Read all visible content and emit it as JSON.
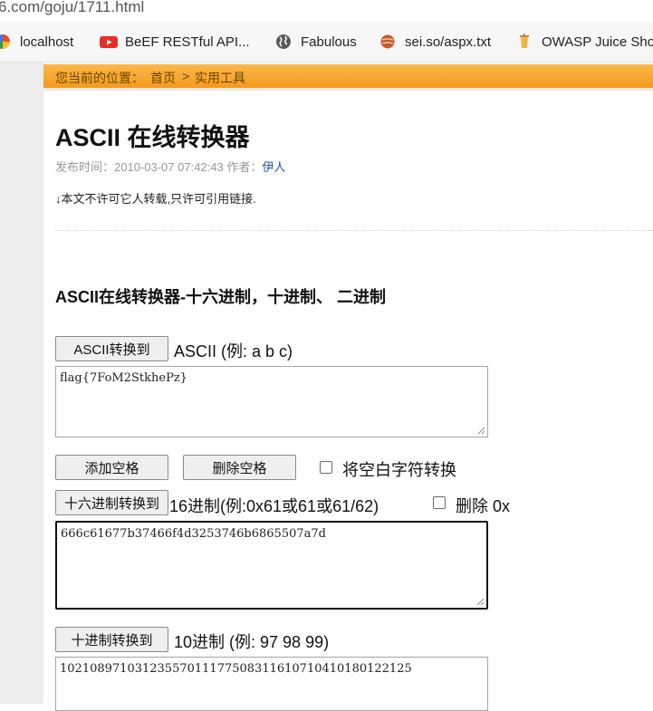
{
  "browser": {
    "url": "6.com/goju/1711.html",
    "bookmarks": [
      {
        "label": "localhost",
        "icon": "pinwheel-icon",
        "color": "#e8492f"
      },
      {
        "label": "BeEF RESTful API...",
        "icon": "youtube-icon",
        "color": "#e52d27"
      },
      {
        "label": "Fabulous",
        "icon": "globe-icon",
        "color": "#555555"
      },
      {
        "label": "sei.so/aspx.txt",
        "icon": "planet-icon",
        "color": "#c45a2c"
      },
      {
        "label": "OWASP Juice Shop",
        "icon": "juice-icon",
        "color": "#e8a23a"
      }
    ]
  },
  "breadcrumb": {
    "prefix": "您当前的位置：",
    "home": "首页",
    "sep": ">",
    "section": "实用工具"
  },
  "article": {
    "title": "ASCII 在线转换器",
    "meta_published_label": "发布时间：",
    "meta_date": "2010-03-07 07:42:43",
    "meta_author_label": "作者：",
    "meta_author": "伊人",
    "notice": "↓本文不许可它人转载,只许可引用链接."
  },
  "tool": {
    "heading": "ASCII在线转换器-十六进制，十进制、 二进制",
    "ascii": {
      "button": "ASCII转换到",
      "label": "ASCII (例: a b c)",
      "value": "flag{7FoM2StkhePz}"
    },
    "spaces": {
      "add_button": "添加空格",
      "remove_button": "删除空格",
      "whitespace_checkbox": "将空白字符转换"
    },
    "hex": {
      "button": "十六进制转换到",
      "label": "16进制(例:0x61或61或61/62)",
      "remove_0x_checkbox": "删除 0x",
      "value": "666c61677b37466f4d3253746b6865507a7d"
    },
    "dec": {
      "button": "十进制转换到",
      "label": "10进制 (例: 97 98 99)",
      "value": "10210897103123557011177508311610710410180122125"
    }
  },
  "colors": {
    "breadcrumb_bar": "#f5a327",
    "link": "#1a57a8"
  }
}
